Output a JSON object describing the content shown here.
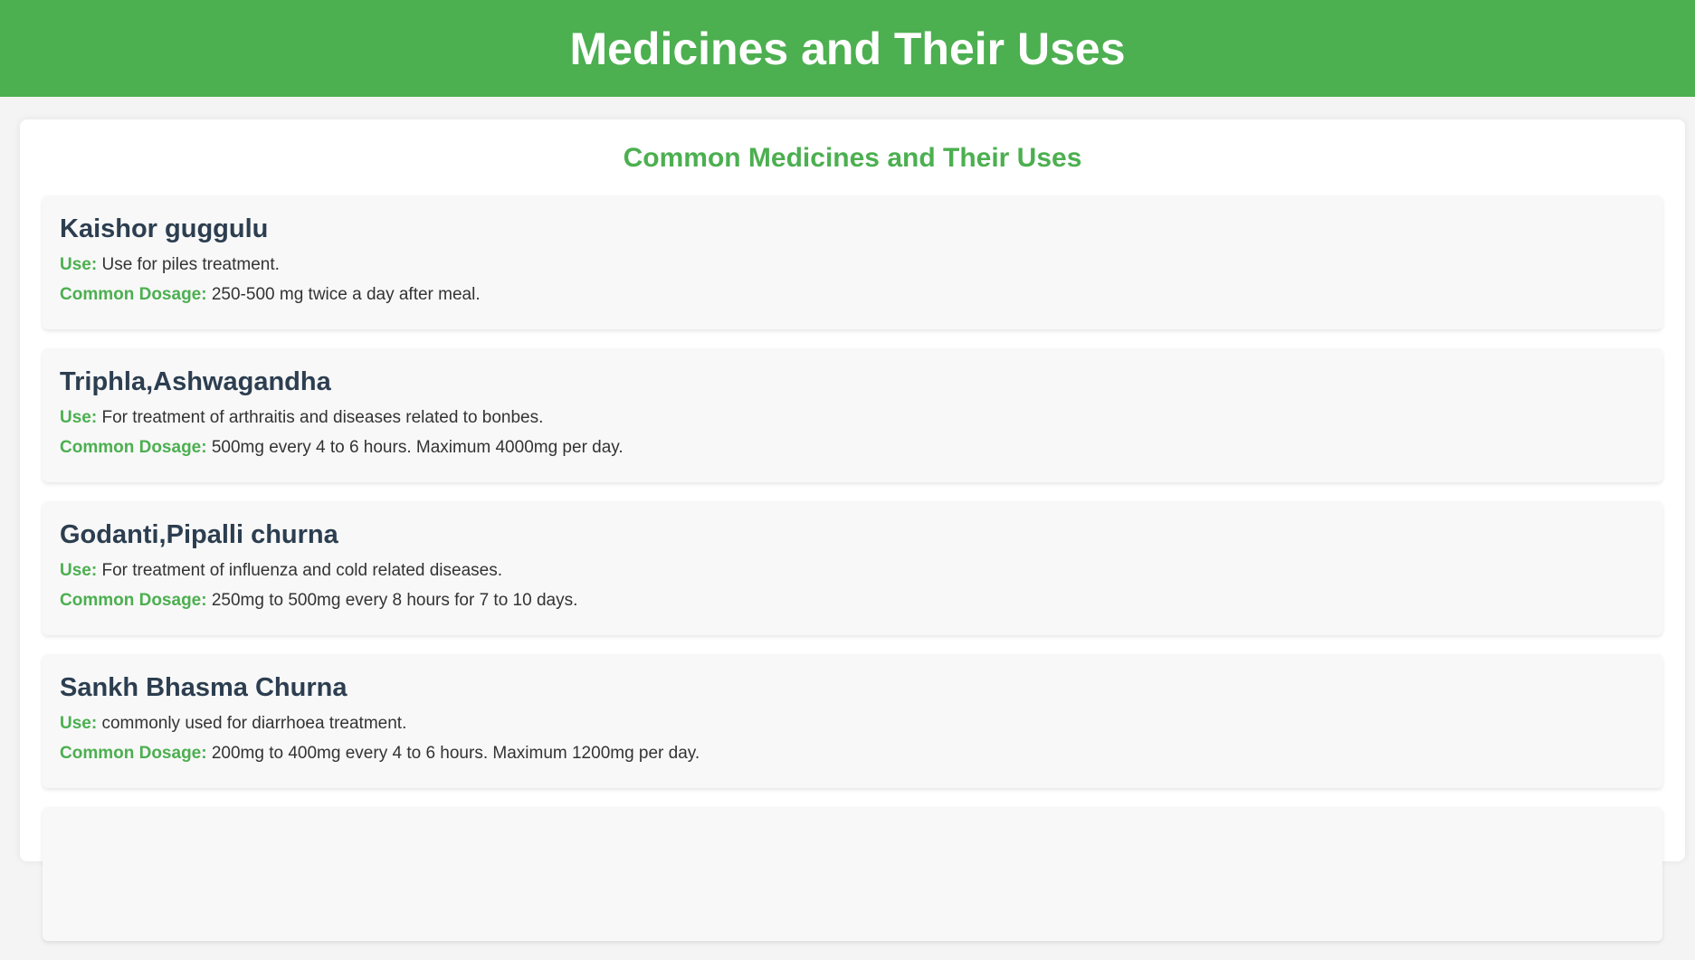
{
  "header": {
    "title": "Medicines and Their Uses"
  },
  "main": {
    "section_title": "Common Medicines and Their Uses",
    "use_label": "Use:",
    "dosage_label": "Common Dosage:",
    "medicines": [
      {
        "name": "Kaishor guggulu",
        "use": "Use for piles treatment.",
        "dosage": "250-500 mg twice a day after meal."
      },
      {
        "name": "Triphla,Ashwagandha",
        "use": "For treatment of arthraitis and diseases related to bonbes.",
        "dosage": "500mg every 4 to 6 hours. Maximum 4000mg per day."
      },
      {
        "name": "Godanti,Pipalli churna",
        "use": "For treatment of influenza and cold related diseases.",
        "dosage": "250mg to 500mg every 8 hours for 7 to 10 days."
      },
      {
        "name": "Sankh Bhasma Churna",
        "use": "commonly used for diarrhoea treatment.",
        "dosage": "200mg to 400mg every 4 to 6 hours. Maximum 1200mg per day."
      }
    ]
  },
  "colors": {
    "brand_green": "#4caf50",
    "heading_dark": "#2c3e50"
  }
}
